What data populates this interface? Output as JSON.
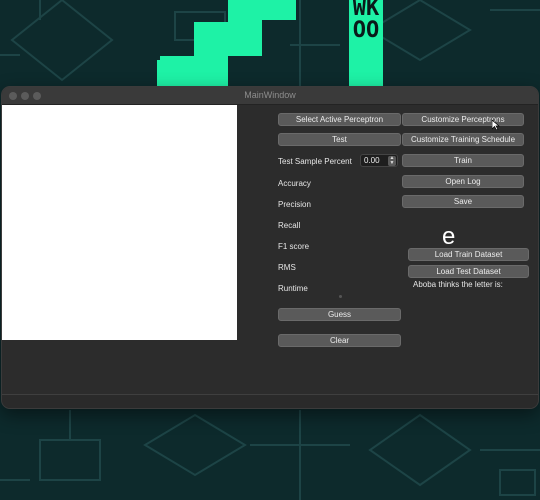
{
  "window": {
    "title": "MainWindow"
  },
  "background": {
    "banner_text": "WKOO"
  },
  "left_column": {
    "select_perceptron_label": "Select Active Perceptron",
    "test_label": "Test",
    "test_sample_percent_label": "Test Sample Percent",
    "test_sample_percent_value": "0.00",
    "metrics": {
      "accuracy": "Accuracy",
      "precision": "Precision",
      "recall": "Recall",
      "f1": "F1 score",
      "rms": "RMS",
      "runtime": "Runtime"
    },
    "guess_label": "Guess",
    "clear_label": "Clear"
  },
  "right_column": {
    "customize_perceptrons_label": "Customize Perceptrons",
    "customize_schedule_label": "Customize Training Schedule",
    "train_label": "Train",
    "open_log_label": "Open Log",
    "save_label": "Save",
    "load_train_label": "Load Train Dataset",
    "load_test_label": "Load Test Dataset",
    "prediction_label": "Aboba thinks the letter is:",
    "predicted_letter": "e"
  },
  "colors": {
    "accent_green": "#1ef2a6",
    "background": "#0d2a2c",
    "window": "#2c2c2c",
    "button": "#5a5a5a"
  }
}
